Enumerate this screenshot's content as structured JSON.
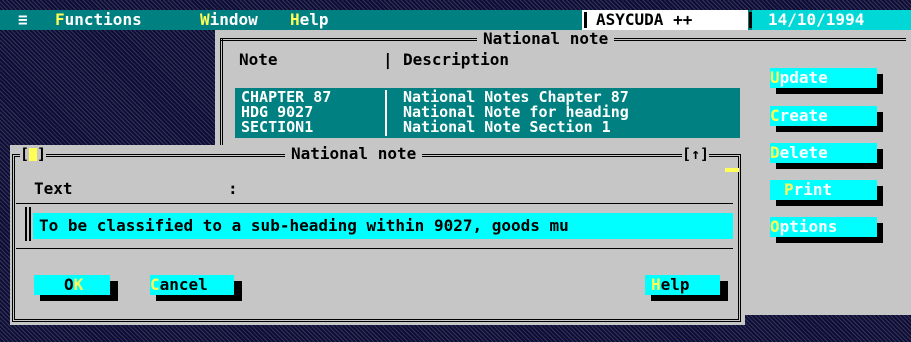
{
  "menubar": {
    "menu_icon": "≡",
    "functions_hot": "F",
    "functions_rest": "unctions",
    "window_hot": "W",
    "window_rest": "indow",
    "help_hot": "H",
    "help_rest": "elp",
    "app_title": "ASYCUDA ++",
    "date": "14/10/1994"
  },
  "bg_window": {
    "title": "National note",
    "col_note": "Note",
    "col_desc_sep": "|",
    "col_desc": "Description",
    "rows": [
      {
        "note": "CHAPTER 87",
        "description": "National Notes Chapter 87"
      },
      {
        "note": "HDG 9027",
        "description": "National Note for heading"
      },
      {
        "note": "SECTION1",
        "description": "National Note Section 1"
      }
    ],
    "buttons": [
      {
        "hot": "U",
        "rest": "pdate"
      },
      {
        "hot": "C",
        "rest": "reate"
      },
      {
        "hot": "D",
        "rest": "elete"
      },
      {
        "hot": "P",
        "rest": "rint"
      },
      {
        "hot": "O",
        "rest": "ptions"
      }
    ]
  },
  "dialog": {
    "title": "National note",
    "left_bracket_open": "[",
    "left_bracket_close": "]",
    "right_bracket": "[↑]",
    "text_label": "Text",
    "text_colon": ":",
    "text_value": "To be classified to a sub-heading within 9027, goods mu",
    "ok_pre": "O",
    "ok_hot": "K",
    "cancel_hot": "C",
    "cancel_rest": "ancel",
    "help_hot": "H",
    "help_rest": "elp"
  },
  "colors": {
    "teal": "#008080",
    "cyan": "#00ffff",
    "gray": "#c6c6c6",
    "hotkey": "#ffff55"
  }
}
